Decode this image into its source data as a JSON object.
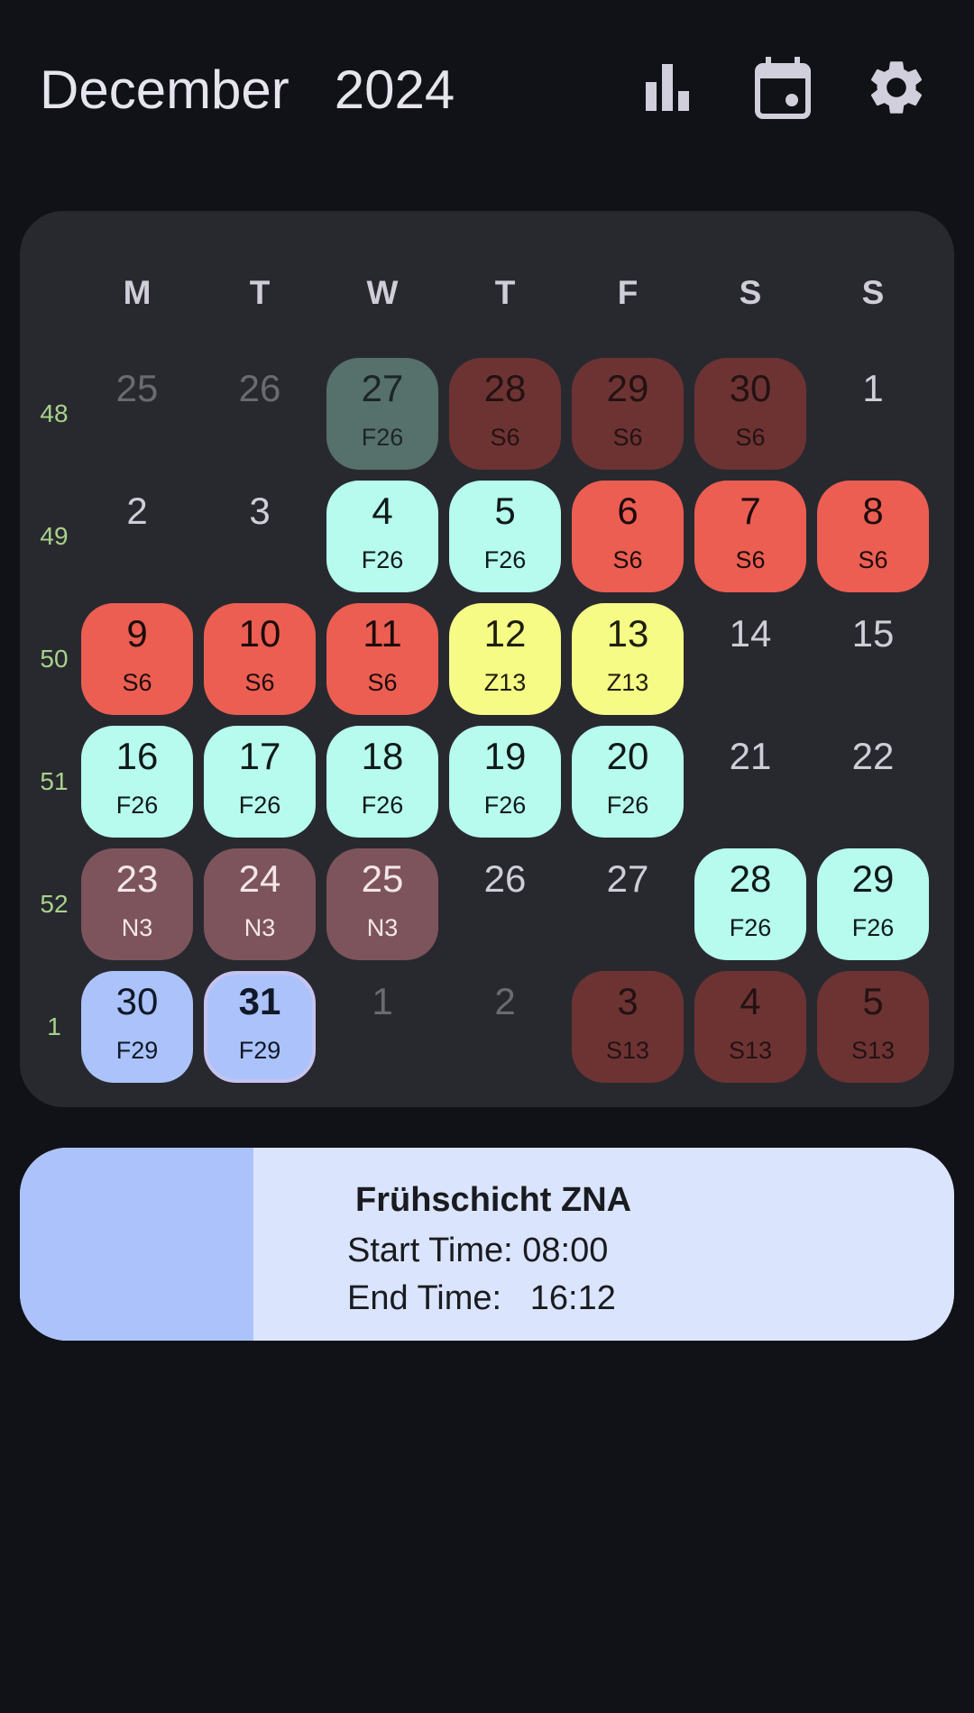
{
  "header": {
    "month": "December",
    "year": "2024",
    "icons": [
      "bar-chart-icon",
      "calendar-icon",
      "gear-icon"
    ]
  },
  "calendar": {
    "weekday_headers": [
      "M",
      "T",
      "W",
      "T",
      "F",
      "S",
      "S"
    ],
    "weeks": [
      {
        "number": "48",
        "days": [
          {
            "day": "25",
            "code": "",
            "style": "dim"
          },
          {
            "day": "26",
            "code": "",
            "style": "dim"
          },
          {
            "day": "27",
            "code": "F26",
            "style": "dimteal"
          },
          {
            "day": "28",
            "code": "S6",
            "style": "dimred"
          },
          {
            "day": "29",
            "code": "S6",
            "style": "dimred"
          },
          {
            "day": "30",
            "code": "S6",
            "style": "dimred"
          },
          {
            "day": "1",
            "code": "",
            "style": "none"
          }
        ]
      },
      {
        "number": "49",
        "days": [
          {
            "day": "2",
            "code": "",
            "style": "none"
          },
          {
            "day": "3",
            "code": "",
            "style": "none"
          },
          {
            "day": "4",
            "code": "F26",
            "style": "teal"
          },
          {
            "day": "5",
            "code": "F26",
            "style": "teal"
          },
          {
            "day": "6",
            "code": "S6",
            "style": "red"
          },
          {
            "day": "7",
            "code": "S6",
            "style": "red"
          },
          {
            "day": "8",
            "code": "S6",
            "style": "red"
          }
        ]
      },
      {
        "number": "50",
        "days": [
          {
            "day": "9",
            "code": "S6",
            "style": "red"
          },
          {
            "day": "10",
            "code": "S6",
            "style": "red"
          },
          {
            "day": "11",
            "code": "S6",
            "style": "red"
          },
          {
            "day": "12",
            "code": "Z13",
            "style": "yellow"
          },
          {
            "day": "13",
            "code": "Z13",
            "style": "yellow"
          },
          {
            "day": "14",
            "code": "",
            "style": "none"
          },
          {
            "day": "15",
            "code": "",
            "style": "none"
          }
        ]
      },
      {
        "number": "51",
        "days": [
          {
            "day": "16",
            "code": "F26",
            "style": "teal"
          },
          {
            "day": "17",
            "code": "F26",
            "style": "teal"
          },
          {
            "day": "18",
            "code": "F26",
            "style": "teal"
          },
          {
            "day": "19",
            "code": "F26",
            "style": "teal"
          },
          {
            "day": "20",
            "code": "F26",
            "style": "teal"
          },
          {
            "day": "21",
            "code": "",
            "style": "none"
          },
          {
            "day": "22",
            "code": "",
            "style": "none"
          }
        ]
      },
      {
        "number": "52",
        "days": [
          {
            "day": "23",
            "code": "N3",
            "style": "mauve"
          },
          {
            "day": "24",
            "code": "N3",
            "style": "mauve"
          },
          {
            "day": "25",
            "code": "N3",
            "style": "mauve"
          },
          {
            "day": "26",
            "code": "",
            "style": "none"
          },
          {
            "day": "27",
            "code": "",
            "style": "none"
          },
          {
            "day": "28",
            "code": "F26",
            "style": "teal"
          },
          {
            "day": "29",
            "code": "F26",
            "style": "teal"
          }
        ]
      },
      {
        "number": "1",
        "days": [
          {
            "day": "30",
            "code": "F29",
            "style": "blue"
          },
          {
            "day": "31",
            "code": "F29",
            "style": "blue today"
          },
          {
            "day": "1",
            "code": "",
            "style": "dim"
          },
          {
            "day": "2",
            "code": "",
            "style": "dim"
          },
          {
            "day": "3",
            "code": "S13",
            "style": "dimred"
          },
          {
            "day": "4",
            "code": "S13",
            "style": "dimred"
          },
          {
            "day": "5",
            "code": "S13",
            "style": "dimred"
          }
        ]
      }
    ]
  },
  "shift_detail": {
    "title": "Frühschicht ZNA",
    "start_label": "Start Time:",
    "start_value": "08:00",
    "end_label": "End Time:",
    "end_value": "16:12",
    "color": "#abc3fa"
  },
  "colors": {
    "background": "#111218",
    "card": "#28292f",
    "week_number": "#a8d28b",
    "teal": "#b6fbee",
    "red": "#ec5e52",
    "yellow": "#f6fb86",
    "mauve": "#7d545b",
    "blue": "#abc3fa",
    "dim_red": "#6d3333",
    "dim_teal": "#56706c"
  }
}
